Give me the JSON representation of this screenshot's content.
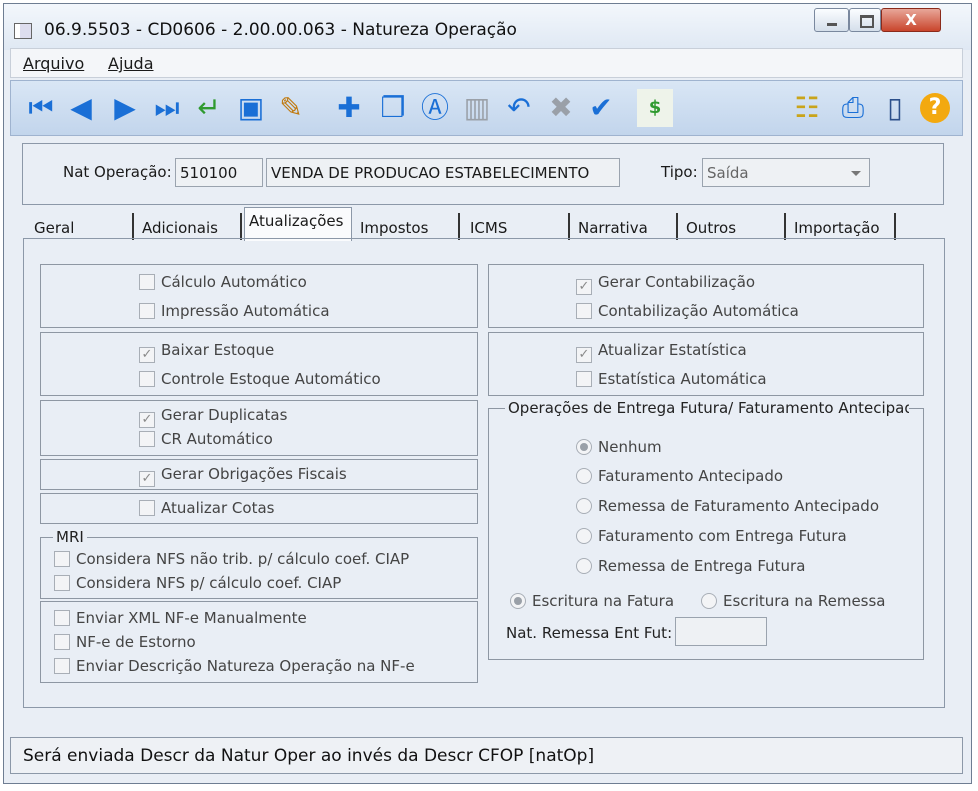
{
  "window": {
    "title": "06.9.5503 - CD0606 - 2.00.00.063 - Natureza Operação",
    "close_glyph": "X"
  },
  "menu": {
    "arquivo": "Arquivo",
    "ajuda": "Ajuda"
  },
  "toolbar": {
    "icons": [
      "first-icon",
      "prev-icon",
      "next-icon",
      "last-icon",
      "enter-icon",
      "preview-icon",
      "edit-icon",
      "new-icon",
      "copy-icon",
      "replace-icon",
      "delete-icon",
      "undo-icon",
      "cancel-icon",
      "confirm-icon",
      "dollar-icon",
      "tree-icon",
      "print-icon",
      "exit-icon",
      "help-icon"
    ],
    "dollar_label": "$",
    "help_label": "?"
  },
  "header": {
    "nat_label": "Nat Operação:",
    "nat_code": "510100",
    "nat_desc": "VENDA DE PRODUCAO ESTABELECIMENTO",
    "tipo_label": "Tipo:",
    "tipo_value": "Saída"
  },
  "tabs": [
    "Geral",
    "Adicionais",
    "Atualizações",
    "Impostos",
    "ICMS",
    "Narrativa",
    "Outros",
    "Importação"
  ],
  "active_tab": "Atualizações",
  "left": {
    "calculo": "Cálculo Automático",
    "impressao": "Impressão Automática",
    "baixar": "Baixar Estoque",
    "controle": "Controle Estoque Automático",
    "duplicatas": "Gerar Duplicatas",
    "cr": "CR Automático",
    "obrigacoes": "Gerar Obrigações Fiscais",
    "cotas": "Atualizar Cotas",
    "mri_legend": "MRI",
    "ciap_nao_trib": "Considera NFS não trib. p/ cálculo coef. CIAP",
    "ciap": "Considera NFS p/ cálculo coef. CIAP",
    "xml": "Enviar XML NF-e Manualmente",
    "estorno": "NF-e de Estorno",
    "descricao": "Enviar Descrição Natureza Operação na NF-e"
  },
  "right": {
    "contab": "Gerar Contabilização",
    "contab_auto": "Contabilização Automática",
    "estatistica": "Atualizar Estatística",
    "estatistica_auto": "Estatística Automática",
    "entrega_legend": "Operações de Entrega Futura/ Faturamento Antecipado",
    "nenhum": "Nenhum",
    "fat_ant": "Faturamento Antecipado",
    "rem_fat_ant": "Remessa de Faturamento Antecipado",
    "fat_entrega": "Faturamento com Entrega Futura",
    "rem_entrega": "Remessa de Entrega Futura",
    "escr_fatura": "Escritura na Fatura",
    "escr_remessa": "Escritura na Remessa",
    "nat_remessa_label": "Nat. Remessa Ent Fut:",
    "nat_remessa_value": ""
  },
  "checked": [
    "Baixar Estoque",
    "Gerar Duplicatas",
    "Gerar Obrigações Fiscais",
    "Gerar Contabilização",
    "Atualizar Estatística"
  ],
  "status": "Será enviada Descr da Natur Oper ao invés da Descr CFOP [natOp]"
}
